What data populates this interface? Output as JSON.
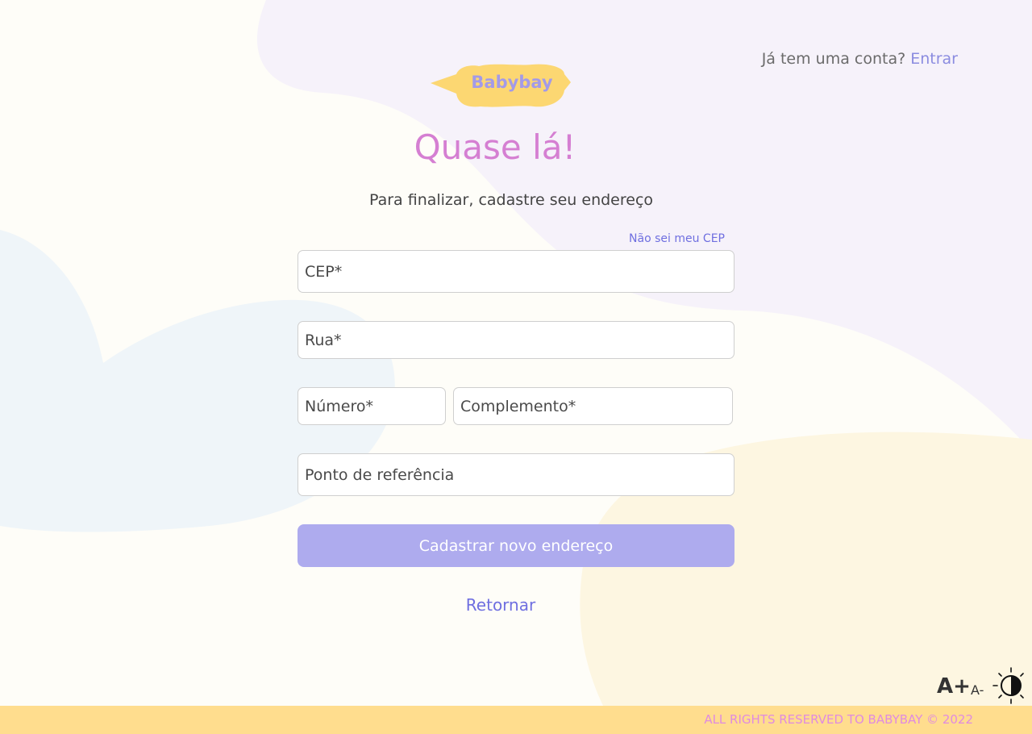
{
  "header": {
    "login_prompt": "Já tem uma conta?",
    "login_link": "Entrar"
  },
  "logo": {
    "text": "Babybay"
  },
  "page": {
    "title": "Quase lá!",
    "subtitle": "Para finalizar, cadastre seu endereço"
  },
  "form": {
    "cep_help": "Não sei meu CEP",
    "cep": {
      "placeholder": "CEP*",
      "value": ""
    },
    "street": {
      "placeholder": "Rua*",
      "value": ""
    },
    "number": {
      "placeholder": "Número*",
      "value": ""
    },
    "complement": {
      "placeholder": "Complemento*",
      "value": ""
    },
    "reference": {
      "placeholder": "Ponto de referência",
      "value": ""
    },
    "submit_label": "Cadastrar novo endereço",
    "back_label": "Retornar"
  },
  "accessibility": {
    "increase_font": "A+",
    "decrease_font": "A-",
    "contrast_icon": "contrast-sun-icon"
  },
  "footer": {
    "text": "ALL RIGHTS RESERVED TO BABYBAY © 2022"
  },
  "colors": {
    "background": "#fefdf8",
    "title": "#d57fd2",
    "accent": "#6f6fe0",
    "button": "#aeabee",
    "logo_bubble": "#fcd772",
    "footer": "#ffdd8e",
    "footer_text": "#e08be0"
  }
}
